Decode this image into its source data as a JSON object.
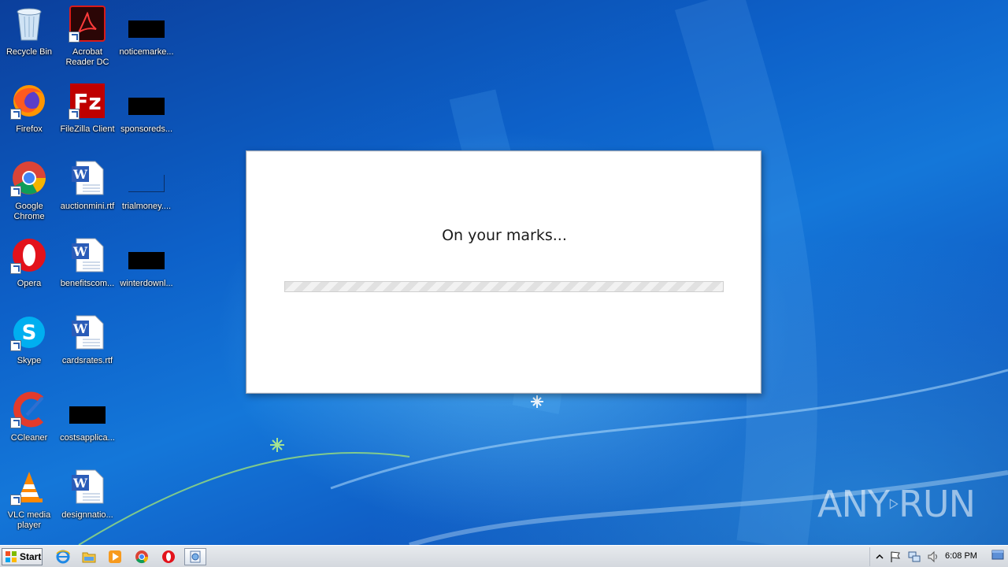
{
  "desktop": {
    "icons": [
      {
        "label": "Recycle Bin"
      },
      {
        "label": "Acrobat Reader DC"
      },
      {
        "label": "noticemarke..."
      },
      {
        "label": "Firefox"
      },
      {
        "label": "FileZilla Client"
      },
      {
        "label": "sponsoreds..."
      },
      {
        "label": "Google Chrome"
      },
      {
        "label": "auctionmini.rtf"
      },
      {
        "label": "trialmoney...."
      },
      {
        "label": "Opera"
      },
      {
        "label": "benefitscom..."
      },
      {
        "label": "winterdownl..."
      },
      {
        "label": "Skype"
      },
      {
        "label": "cardsrates.rtf"
      },
      {
        "label": "CCleaner"
      },
      {
        "label": "costsapplica..."
      },
      {
        "label": "VLC media player"
      },
      {
        "label": "designnatio..."
      }
    ]
  },
  "dialog": {
    "message": "On your marks...",
    "progress": 1.0
  },
  "watermark": {
    "text_left": "ANY",
    "text_right": "RUN"
  },
  "taskbar": {
    "start_label": "Start",
    "clock": "6:08 PM"
  },
  "colors": {
    "taskbar_bg": "#d4d8de",
    "desktop_blue": "#0d61c9",
    "dialog_bg": "#ffffff"
  },
  "icons": {
    "recycle_bin": "recycle-bin-icon",
    "acrobat": "acrobat-icon",
    "firefox": "firefox-icon",
    "filezilla": "filezilla-icon",
    "chrome": "chrome-icon",
    "opera": "opera-icon",
    "skype": "skype-icon",
    "ccleaner": "ccleaner-icon",
    "vlc": "vlc-icon",
    "word_doc": "word-document-icon"
  }
}
